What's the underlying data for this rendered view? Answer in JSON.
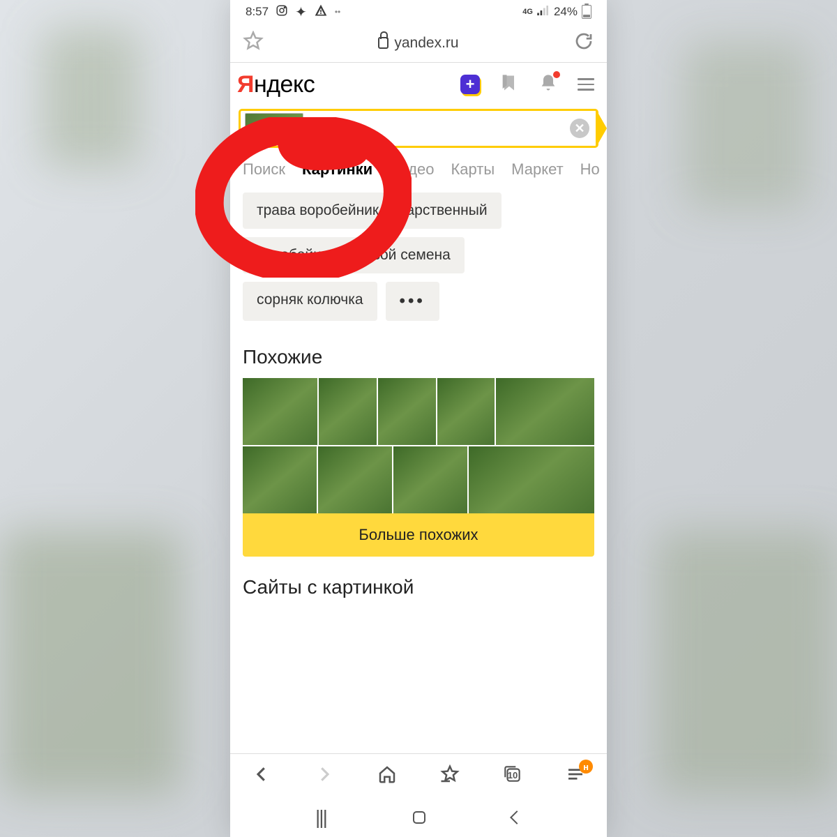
{
  "status": {
    "time": "8:57",
    "battery_pct": "24%"
  },
  "address_bar": {
    "domain": "yandex.ru"
  },
  "logo": {
    "accent": "Я",
    "rest": "ндекс"
  },
  "tabs": [
    {
      "label": "Поиск",
      "active": false
    },
    {
      "label": "Картинки",
      "active": true
    },
    {
      "label": "Видео",
      "active": false
    },
    {
      "label": "Карты",
      "active": false
    },
    {
      "label": "Маркет",
      "active": false
    },
    {
      "label": "Но",
      "active": false
    }
  ],
  "chips": [
    "трава воробейник лекарственный",
    "воробейник полевой семена",
    "сорняк колючка"
  ],
  "chip_more": "•••",
  "sections": {
    "similar_title": "Похожие",
    "more_button": "Больше похожих",
    "sites_title": "Сайты с картинкой"
  },
  "bottom_bar": {
    "tabs_count": "10",
    "badge": "н"
  },
  "colors": {
    "accent_yellow": "#ffcc00",
    "accent_red": "#f23c2e",
    "annotation_red": "#ee1c1c"
  }
}
